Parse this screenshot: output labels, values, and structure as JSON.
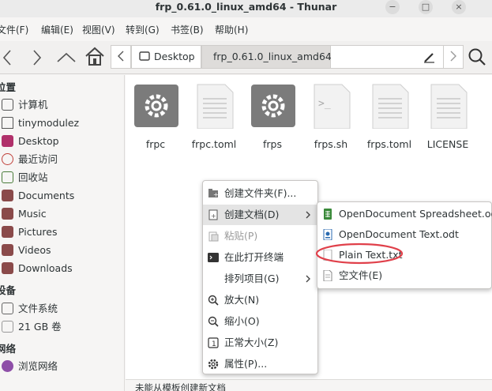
{
  "window": {
    "title": "frp_0.61.0_linux_amd64 - Thunar",
    "buttons": [
      "−",
      "□",
      "×"
    ]
  },
  "menubar": [
    "文件(F)",
    "编辑(E)",
    "视图(V)",
    "转到(G)",
    "书签(B)",
    "帮助(H)"
  ],
  "toolbar": {
    "crumbs": [
      "Desktop",
      "frp_0.61.0_linux_amd64"
    ]
  },
  "sidebar": {
    "sections": [
      {
        "header": "位置",
        "items": [
          {
            "label": "计算机",
            "icon": "computer-icon",
            "color": "#555555"
          },
          {
            "label": "tinymodulez",
            "icon": "home-icon",
            "color": "#555555"
          },
          {
            "label": "Desktop",
            "icon": "desktop-icon",
            "color": "#b0306a"
          },
          {
            "label": "最近访问",
            "icon": "recent-icon",
            "color": "#c0403a"
          },
          {
            "label": "回收站",
            "icon": "trash-icon",
            "color": "#4a7c3a"
          },
          {
            "label": "Documents",
            "icon": "documents-icon",
            "color": "#8a4a4a"
          },
          {
            "label": "Music",
            "icon": "music-icon",
            "color": "#8a4a4a"
          },
          {
            "label": "Pictures",
            "icon": "pictures-icon",
            "color": "#8a4a4a"
          },
          {
            "label": "Videos",
            "icon": "videos-icon",
            "color": "#8a4a4a"
          },
          {
            "label": "Downloads",
            "icon": "downloads-icon",
            "color": "#8a4a4a"
          }
        ]
      },
      {
        "header": "设备",
        "items": [
          {
            "label": "文件系统",
            "icon": "filesystem-icon",
            "color": "#666666"
          },
          {
            "label": "21 GB 卷",
            "icon": "drive-icon",
            "color": "#999999"
          }
        ]
      },
      {
        "header": "网络",
        "items": [
          {
            "label": "浏览网络",
            "icon": "network-icon",
            "color": "#8e4fa8"
          }
        ]
      }
    ]
  },
  "files": [
    {
      "name": "frpc",
      "type": "executable"
    },
    {
      "name": "frpc.toml",
      "type": "text"
    },
    {
      "name": "frps",
      "type": "executable"
    },
    {
      "name": "frps.sh",
      "type": "script"
    },
    {
      "name": "frps.toml",
      "type": "text"
    },
    {
      "name": "LICENSE",
      "type": "text"
    }
  ],
  "context_menu": [
    {
      "label": "创建文件夹(F)...",
      "icon": "new-folder-icon"
    },
    {
      "label": "创建文档(D)",
      "icon": "new-document-icon",
      "submenu": true,
      "highlight": true
    },
    {
      "label": "粘贴(P)",
      "icon": "paste-icon",
      "disabled": true
    },
    {
      "label": "在此打开终端",
      "icon": "terminal-icon"
    },
    {
      "label": "排列项目(G)",
      "icon": "",
      "submenu": true
    },
    {
      "label": "放大(N)",
      "icon": "zoom-in-icon"
    },
    {
      "label": "缩小(O)",
      "icon": "zoom-out-icon"
    },
    {
      "label": "正常大小(Z)",
      "icon": "zoom-normal-icon"
    },
    {
      "label": "属性(P)...",
      "icon": "properties-icon"
    }
  ],
  "submenu": [
    {
      "label": "OpenDocument Spreadsheet.ods",
      "icon": "spreadsheet-icon",
      "color": "#3a8a3a"
    },
    {
      "label": "OpenDocument Text.odt",
      "icon": "text-doc-icon",
      "color": "#2a6ab0"
    },
    {
      "label": "Plain Text.txt",
      "icon": "plain-text-icon",
      "color": "#888888",
      "circled": true
    },
    {
      "label": "空文件(E)",
      "icon": "empty-file-icon",
      "color": "#888888"
    }
  ],
  "colors": {
    "annotation": "#e0404a",
    "highlight": "#e4e4e4"
  },
  "status": "未能从模板创建新文档"
}
